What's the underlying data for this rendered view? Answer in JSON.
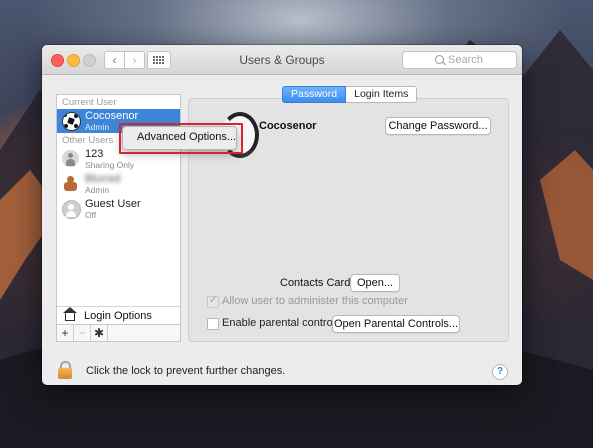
{
  "window": {
    "title": "Users & Groups"
  },
  "toolbar": {
    "back": "‹",
    "forward": "›",
    "search_placeholder": "Search"
  },
  "sidebar": {
    "current_user_header": "Current User",
    "other_users_header": "Other Users",
    "current_user": {
      "name": "Cocosenor",
      "role": "Admin"
    },
    "other_users": [
      {
        "name": "123",
        "role": "Sharing Only"
      },
      {
        "name": "Blurred",
        "role": "Admin"
      },
      {
        "name": "Guest User",
        "role": "Off"
      }
    ],
    "login_options": "Login Options",
    "add": "+",
    "remove": "−",
    "gear": "✱"
  },
  "tabs": [
    {
      "label": "Password",
      "active": true
    },
    {
      "label": "Login Items",
      "active": false
    }
  ],
  "account": {
    "name": "Cocosenor",
    "change_password_button": "Change Password..."
  },
  "context_menu": {
    "item": "Advanced Options..."
  },
  "contacts": {
    "label": "Contacts Card:",
    "open_button": "Open..."
  },
  "options": {
    "allow_admin": {
      "label": "Allow user to administer this computer",
      "checked": true,
      "disabled": true
    },
    "parental": {
      "label": "Enable parental controls",
      "checked": false,
      "button": "Open Parental Controls..."
    }
  },
  "footer": {
    "lock_text": "Click the lock to prevent further changes.",
    "help": "?"
  },
  "colors": {
    "selection": "#3c85d9",
    "highlight_box": "#d4262c",
    "tab_active": "#3a8cf0"
  }
}
